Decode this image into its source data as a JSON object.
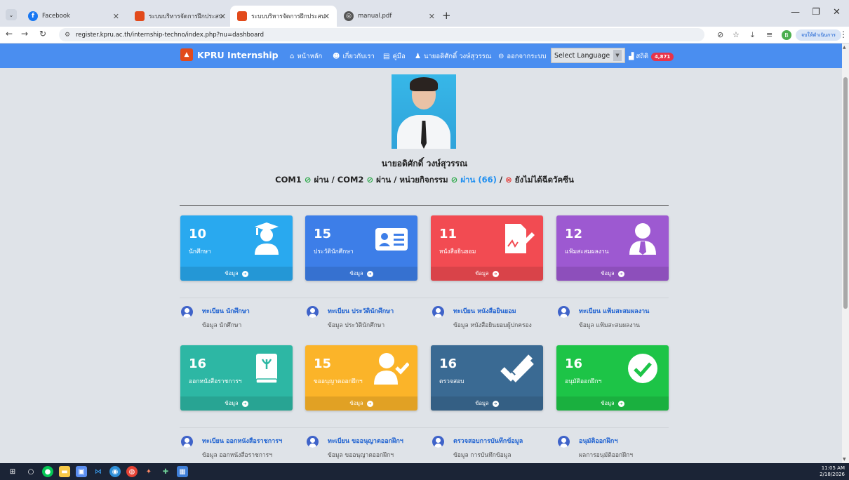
{
  "browser": {
    "tabs": [
      {
        "title": "Facebook",
        "icon": "facebook-icon",
        "color": "#1877f2"
      },
      {
        "title": "ระบบบริหารจัดการฝึกประสบการณ์วิช",
        "icon": "kpru-icon",
        "color": "#e24a1b"
      },
      {
        "title": "ระบบบริหารจัดการฝึกประสบการณ์วิช",
        "icon": "kpru-icon",
        "color": "#e24a1b",
        "active": true
      },
      {
        "title": "manual.pdf",
        "icon": "globe-icon",
        "color": "#555555"
      }
    ],
    "url": "register.kpru.ac.th/internship-techno/index.php?nu=dashboard",
    "finish_label": "จบให้ดำเนินการ",
    "profile_initial": "B"
  },
  "nav": {
    "brand": "KPRU Internship",
    "items": [
      {
        "label": "หน้าหลัก",
        "icon": "home-icon",
        "glyph": "⌂"
      },
      {
        "label": "เกี่ยวกับเรา",
        "icon": "users-icon",
        "glyph": "☻"
      },
      {
        "label": "คู่มือ",
        "icon": "document-icon",
        "glyph": "▤"
      },
      {
        "label": "นายอดิศักดิ์ วงษ์สุวรรณ",
        "icon": "user-icon",
        "glyph": "♟"
      },
      {
        "label": "ออกจากระบบ",
        "icon": "logout-icon",
        "glyph": "⊖"
      }
    ],
    "language": "Select Language",
    "stat_label": "สถิติ",
    "stat_badge": "4,871"
  },
  "profile": {
    "name": "นายอดิศักดิ์ วงษ์สุวรรณ",
    "com1": "COM1",
    "com2": "COM2",
    "pass": "ผ่าน",
    "activity": "หน่วยกิจกรรม",
    "activity_result": "ผ่าน (66)",
    "vaccine": "ยังไม่ได้ฉีดวัคซีน"
  },
  "cards": [
    {
      "count": "10",
      "label": "นักศึกษา",
      "footer": "ข้อมูล",
      "color": "#29a9ef",
      "icon": "graduate-icon"
    },
    {
      "count": "15",
      "label": "ประวัตินักศึกษา",
      "footer": "ข้อมูล",
      "color": "#3d7ee8",
      "icon": "id-card-icon"
    },
    {
      "count": "11",
      "label": "หนังสือยินยอม",
      "footer": "ข้อมูล",
      "color": "#f24b52",
      "icon": "signature-icon"
    },
    {
      "count": "12",
      "label": "แฟ้มสะสมผลงาน",
      "footer": "ข้อมูล",
      "color": "#9d59d1",
      "icon": "user-tie-icon"
    },
    {
      "count": "16",
      "label": "ออกหนังสือราชการฯ",
      "footer": "ข้อมูล",
      "color": "#2db7a4",
      "icon": "book-icon"
    },
    {
      "count": "15",
      "label": "ขออนุญาตออกฝึกฯ",
      "footer": "ข้อมูล",
      "color": "#fbb429",
      "icon": "user-check-icon"
    },
    {
      "count": "16",
      "label": "ตรวจสอบ",
      "footer": "ข้อมูล",
      "color": "#3a6a93",
      "icon": "double-check-icon"
    },
    {
      "count": "16",
      "label": "อนุมัติออกฝึกฯ",
      "footer": "ข้อมูล",
      "color": "#1dc447",
      "icon": "check-circle-icon"
    }
  ],
  "info": [
    {
      "title": "ทะเบียน นักศึกษา",
      "sub": "ข้อมูล นักศึกษา"
    },
    {
      "title": "ทะเบียน ประวัตินักศึกษา",
      "sub": "ข้อมูล ประวัตินักศึกษา"
    },
    {
      "title": "ทะเบียน หนังสือยินยอม",
      "sub": "ข้อมูล หนังสือยินยอมผู้ปกครอง"
    },
    {
      "title": "ทะเบียน แฟ้มสะสมผลงาน",
      "sub": "ข้อมูล แฟ้มสะสมผลงาน"
    },
    {
      "title": "ทะเบียน ออกหนังสือราชการฯ",
      "sub": "ข้อมูล ออกหนังสือราชการฯ"
    },
    {
      "title": "ทะเบียน ขออนุญาตออกฝึกฯ",
      "sub": "ข้อมูล ขออนุญาตออกฝึกฯ"
    },
    {
      "title": "ตรวจสอบการบันทึกข้อมูล",
      "sub": "ข้อมูล การบันทึกข้อมูล"
    },
    {
      "title": "อนุมัติออกฝึกฯ",
      "sub": "ผลการอนุมัติออกฝึกฯ"
    }
  ],
  "taskbar": {
    "time": "11:05 AM",
    "date": "2/18/2026"
  }
}
